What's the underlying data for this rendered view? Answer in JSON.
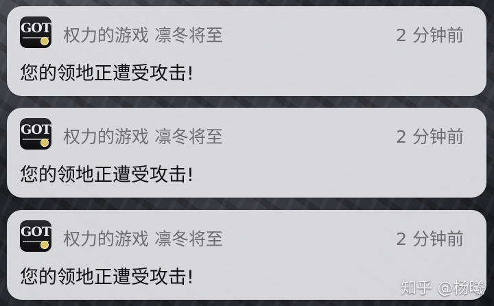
{
  "notifications": [
    {
      "app_icon": "game-of-thrones-app-icon",
      "icon_text": "GOT",
      "app_name": "权力的游戏 凛冬将至",
      "time": "2 分钟前",
      "message": "您的领地正遭受攻击!"
    },
    {
      "app_icon": "game-of-thrones-app-icon",
      "icon_text": "GOT",
      "app_name": "权力的游戏 凛冬将至",
      "time": "2 分钟前",
      "message": "您的领地正遭受攻击!"
    },
    {
      "app_icon": "game-of-thrones-app-icon",
      "icon_text": "GOT",
      "app_name": "权力的游戏 凛冬将至",
      "time": "2 分钟前",
      "message": "您的领地正遭受攻击!"
    }
  ],
  "watermark": "知乎 @杨曦"
}
